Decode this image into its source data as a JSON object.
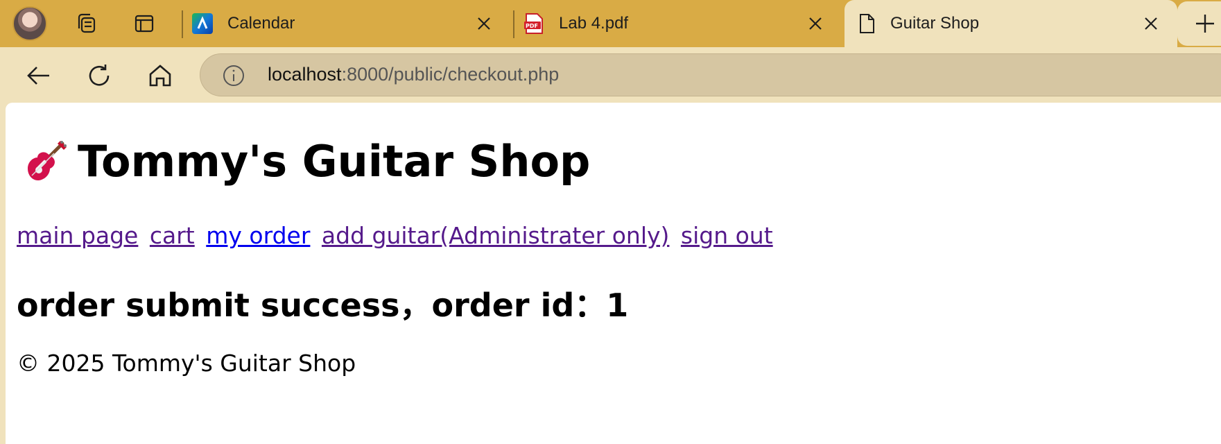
{
  "browser": {
    "tabs": [
      {
        "title": "Calendar",
        "favicon": "calendar-app-icon",
        "active": false
      },
      {
        "title": "Lab 4.pdf",
        "favicon": "pdf-icon",
        "active": false
      },
      {
        "title": "Guitar Shop",
        "favicon": "page-icon",
        "active": true
      }
    ],
    "address_host": "localhost",
    "address_path": ":8000/public/checkout.php",
    "colors": {
      "tab_strip": "#d9ab45",
      "active_tab": "#f0e2bc",
      "omnibox": "#d6c6a2"
    }
  },
  "page": {
    "title": "Tommy's Guitar Shop",
    "title_icon": "guitar-emoji",
    "nav": [
      {
        "label": "main page",
        "visited": true
      },
      {
        "label": "cart",
        "visited": true
      },
      {
        "label": "my order",
        "visited": false
      },
      {
        "label": "add guitar(Administrater only)",
        "visited": true
      },
      {
        "label": "sign out",
        "visited": true
      }
    ],
    "message": "order submit success，order id：1",
    "footer": "© 2025 Tommy's Guitar Shop",
    "link_colors": {
      "visited": "#551a8b",
      "unvisited": "#0000ee"
    }
  }
}
